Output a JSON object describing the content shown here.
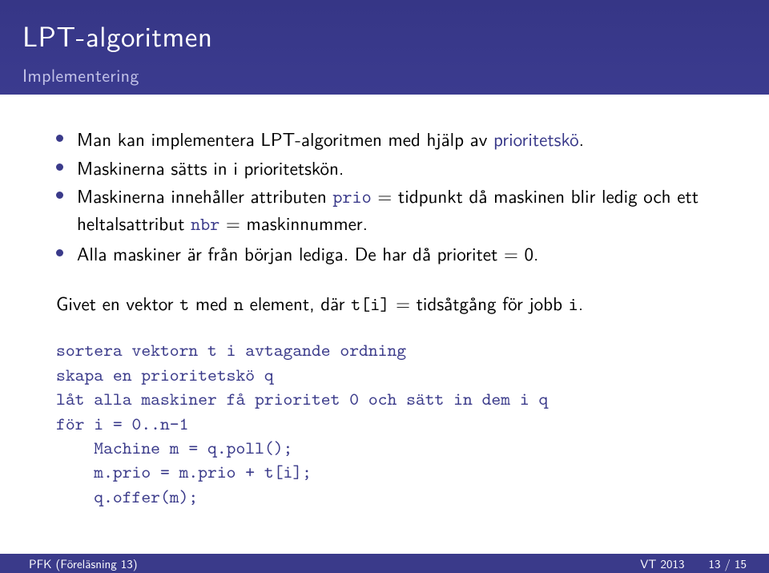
{
  "header": {
    "title": "LPT-algoritmen",
    "subtitle": "Implementering"
  },
  "bullets": [
    {
      "pre": "Man kan implementera LPT-algoritmen med hjälp av ",
      "blue": "prioritetskö",
      "post": "."
    },
    {
      "pre": "Maskinerna sätts in i prioritetskön.",
      "blue": "",
      "post": ""
    },
    {
      "segments": {
        "a": "Maskinerna innehåller attributen ",
        "prio": "prio",
        "b": " = tidpunkt då maskinen blir ledig och ett heltalsattribut ",
        "nbr": "nbr",
        "c": " = maskinnummer."
      }
    },
    {
      "pre": "Alla maskiner är från början lediga. De har då prioritet = 0.",
      "blue": "",
      "post": ""
    }
  ],
  "given": {
    "a": "Givet en vektor ",
    "t1": "t",
    "b": " med ",
    "n": "n",
    "c": " element, där ",
    "ti": "t[i]",
    "d": " = tidsåtgång för jobb ",
    "i": "i",
    "e": "."
  },
  "code": "sortera vektorn t i avtagande ordning\nskapa en prioritetskö q\nlåt alla maskiner få prioritet 0 och sätt in dem i q\nför i = 0..n-1\n    Machine m = q.poll();\n    m.prio = m.prio + t[i];\n    q.offer(m);",
  "footer": {
    "left": "PFK (Föreläsning 13)",
    "center": "",
    "right_term": "VT 2013",
    "right_page": "13 / 15"
  }
}
